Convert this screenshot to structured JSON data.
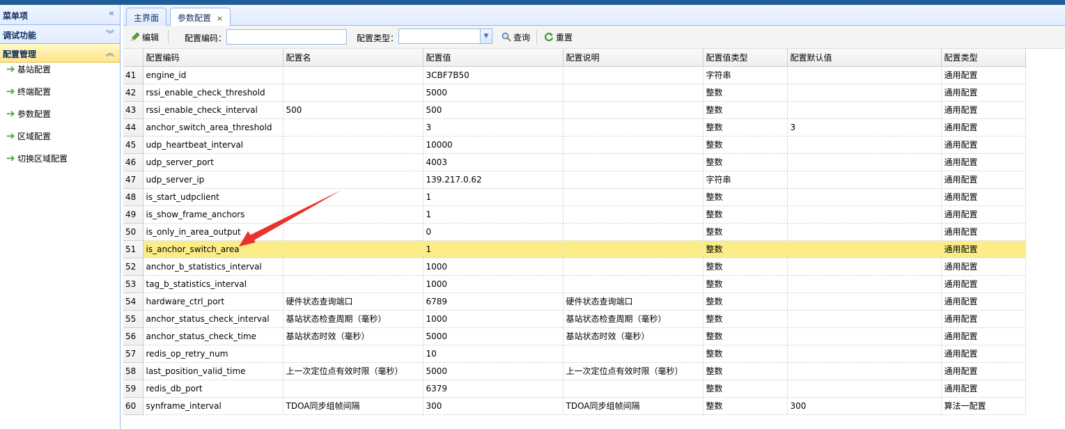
{
  "sidebar": {
    "header": "菜单项",
    "header_collapse": "«",
    "sections": [
      {
        "label": "调试功能",
        "chev": "︾"
      },
      {
        "label": "配置管理",
        "chev": "︽"
      }
    ],
    "items": [
      {
        "label": "基站配置"
      },
      {
        "label": "终端配置"
      },
      {
        "label": "参数配置"
      },
      {
        "label": "区域配置"
      },
      {
        "label": "切换区域配置"
      }
    ]
  },
  "tabs": [
    {
      "label": "主界面"
    },
    {
      "label": "参数配置",
      "close": "×"
    }
  ],
  "toolbar": {
    "edit_label": "编辑",
    "code_label": "配置编码：",
    "code_value": "",
    "type_label": "配置类型：",
    "type_value": "",
    "search_label": "查询",
    "reset_label": "重置"
  },
  "table": {
    "headers": [
      "配置编码",
      "配置名",
      "配置值",
      "配置说明",
      "配置值类型",
      "配置默认值",
      "配置类型"
    ],
    "rows": [
      [
        "41",
        "engine_id",
        "",
        "3CBF7B50",
        "",
        "字符串",
        "",
        "通用配置"
      ],
      [
        "42",
        "rssi_enable_check_threshold",
        "",
        "5000",
        "",
        "整数",
        "",
        "通用配置"
      ],
      [
        "43",
        "rssi_enable_check_interval",
        "500",
        "500",
        "",
        "整数",
        "",
        "通用配置"
      ],
      [
        "44",
        "anchor_switch_area_threshold",
        "",
        "3",
        "",
        "整数",
        "3",
        "通用配置"
      ],
      [
        "45",
        "udp_heartbeat_interval",
        "",
        "10000",
        "",
        "整数",
        "",
        "通用配置"
      ],
      [
        "46",
        "udp_server_port",
        "",
        "4003",
        "",
        "整数",
        "",
        "通用配置"
      ],
      [
        "47",
        "udp_server_ip",
        "",
        "139.217.0.62",
        "",
        "字符串",
        "",
        "通用配置"
      ],
      [
        "48",
        "is_start_udpclient",
        "",
        "1",
        "",
        "整数",
        "",
        "通用配置"
      ],
      [
        "49",
        "is_show_frame_anchors",
        "",
        "1",
        "",
        "整数",
        "",
        "通用配置"
      ],
      [
        "50",
        "is_only_in_area_output",
        "",
        "0",
        "",
        "整数",
        "",
        "通用配置"
      ],
      [
        "51",
        "is_anchor_switch_area",
        "",
        "1",
        "",
        "整数",
        "",
        "通用配置"
      ],
      [
        "52",
        "anchor_b_statistics_interval",
        "",
        "1000",
        "",
        "整数",
        "",
        "通用配置"
      ],
      [
        "53",
        "tag_b_statistics_interval",
        "",
        "1000",
        "",
        "整数",
        "",
        "通用配置"
      ],
      [
        "54",
        "hardware_ctrl_port",
        "硬件状态查询端口",
        "6789",
        "硬件状态查询端口",
        "整数",
        "",
        "通用配置"
      ],
      [
        "55",
        "anchor_status_check_interval",
        "基站状态检查周期（毫秒）",
        "1000",
        "基站状态检查周期（毫秒）",
        "整数",
        "",
        "通用配置"
      ],
      [
        "56",
        "anchor_status_check_time",
        "基站状态时效（毫秒）",
        "5000",
        "基站状态时效（毫秒）",
        "整数",
        "",
        "通用配置"
      ],
      [
        "57",
        "redis_op_retry_num",
        "",
        "10",
        "",
        "整数",
        "",
        "通用配置"
      ],
      [
        "58",
        "last_position_valid_time",
        "上一次定位点有效时限（毫秒）",
        "5000",
        "上一次定位点有效时限（毫秒）",
        "整数",
        "",
        "通用配置"
      ],
      [
        "59",
        "redis_db_port",
        "",
        "6379",
        "",
        "整数",
        "",
        "通用配置"
      ],
      [
        "60",
        "synframe_interval",
        "TDOA同步组帧间隔",
        "300",
        "TDOA同步组帧间隔",
        "整数",
        "300",
        "算法一配置"
      ]
    ],
    "highlighted_row": "51"
  },
  "colors": {
    "highlight": "#fbec88",
    "arrow": "#e8322b",
    "border": "#95b8e7"
  }
}
